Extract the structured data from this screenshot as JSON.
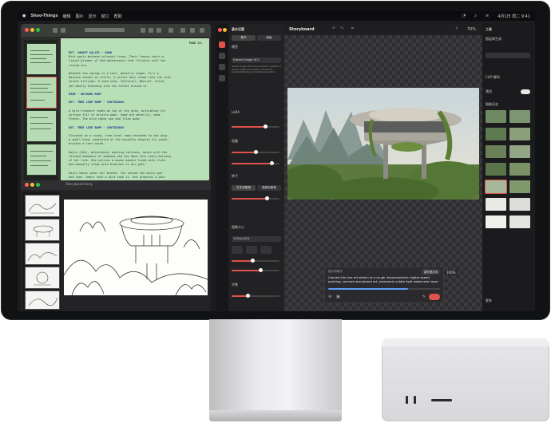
{
  "menubar": {
    "app_name": "Shoo-Things",
    "menus": [
      "编辑",
      "图片",
      "显示",
      "窗口",
      "帮助"
    ],
    "clock": "4月1日 周二 9:41"
  },
  "script_window": {
    "page_label": "PAGE 29.",
    "lines": [
      {
        "t": "EXT. CANOPY VALLEY - DAWN",
        "h": true
      },
      {
        "t": "Mist pools between colossal trees. Their leaves catch a",
        "h": false
      },
      {
        "t": "liquid glimmer of bioluminescence that flickers with the",
        "h": false
      },
      {
        "t": "rising sun.",
        "h": false
      },
      {
        "t": "",
        "h": false
      },
      {
        "t": "Beneath the canopy is a tent, metallic shape. It's a",
        "h": false
      },
      {
        "t": "massive vessel on stilts, a silver disc fused into the lush",
        "h": false
      },
      {
        "t": "forest hillside. A seed ship. Technical. Natural. Alive,",
        "h": false
      },
      {
        "t": "yet mostly blending into the forest around it.",
        "h": false
      },
      {
        "t": "",
        "h": false
      },
      {
        "t": "HIDE - ORCHARD ROOF",
        "h": true
      },
      {
        "t": "",
        "h": false
      },
      {
        "t": "EXT. TREE LINE RAMP - CONTINUOUS",
        "h": true
      },
      {
        "t": "",
        "h": false
      },
      {
        "t": "A bird treasure lands on top of the ship, activating its",
        "h": false
      },
      {
        "t": "surface full of bristle pods. Some are metallic, some",
        "h": false
      },
      {
        "t": "Plants. The bird takes one and flies away.",
        "h": false
      },
      {
        "t": "",
        "h": false
      },
      {
        "t": "EXT. TREE LINE RAMP - CONTINUOUS",
        "h": true
      },
      {
        "t": "",
        "h": false
      },
      {
        "t": "Elevated on a round, tree-level ramp attached to the ship,",
        "h": false
      },
      {
        "t": "a small hand, weathered at the knuckles despite its youth,",
        "h": false
      },
      {
        "t": "brushes a leaf aside.",
        "h": false
      },
      {
        "t": "",
        "h": false
      },
      {
        "t": "Kayla (20s), determined, wearing calluses, moves with the",
        "h": false
      },
      {
        "t": "relaxed demeanor of someone who has done this every morning",
        "h": false
      },
      {
        "t": "of her life. She carries a woven basket lined with cloth",
        "h": false
      },
      {
        "t": "and manually steps onto branches in her path.",
        "h": false
      },
      {
        "t": "",
        "h": false
      },
      {
        "t": "Kayla takes under her breath. The volume the misty god",
        "h": false
      },
      {
        "t": "and town. wears that a bird took it. She prepares a pair",
        "h": false
      }
    ]
  },
  "storyboard_window": {
    "title": "Storyboard.key"
  },
  "params_panel": {
    "title": "基本设置",
    "tab_basic": "基本",
    "tab_advanced": "高级",
    "section_model": "模型",
    "model_value": "Dream Image XC2",
    "model_desc": "Dream Image XC2 is the powerful system of visual image model with unmatched prompt-following and detail generation.",
    "section_lora": "LoRA",
    "section_trigger": "权重",
    "section_seed": "种子",
    "btn_text_to_image": "文本到图像",
    "btn_image_to_image": "图像到图像",
    "section_size": "图像大小",
    "size_value": "1024x1024",
    "section_steps": "步数"
  },
  "canvas": {
    "title": "Storyboard",
    "prompt_tag": "提示词助手",
    "prompt_button": "重写提示词",
    "prompt_text": "Convert the line art sketch to a rough impressionistic digital speed painting, concept storyboard art, extremely subtle light watercolor layer.",
    "zoom": "100%",
    "sub_zoom": "70%"
  },
  "layers_panel": {
    "title": "工具",
    "section_layers": "图层和生成",
    "section_clip": "CLIP 解码",
    "toggle_label": "预览",
    "section_history": "图像历史",
    "section_more": "更多"
  },
  "colors": {
    "accent": "#e0524a",
    "script_paper": "#b9dfb6",
    "heading_blue": "#1a3a8a"
  }
}
